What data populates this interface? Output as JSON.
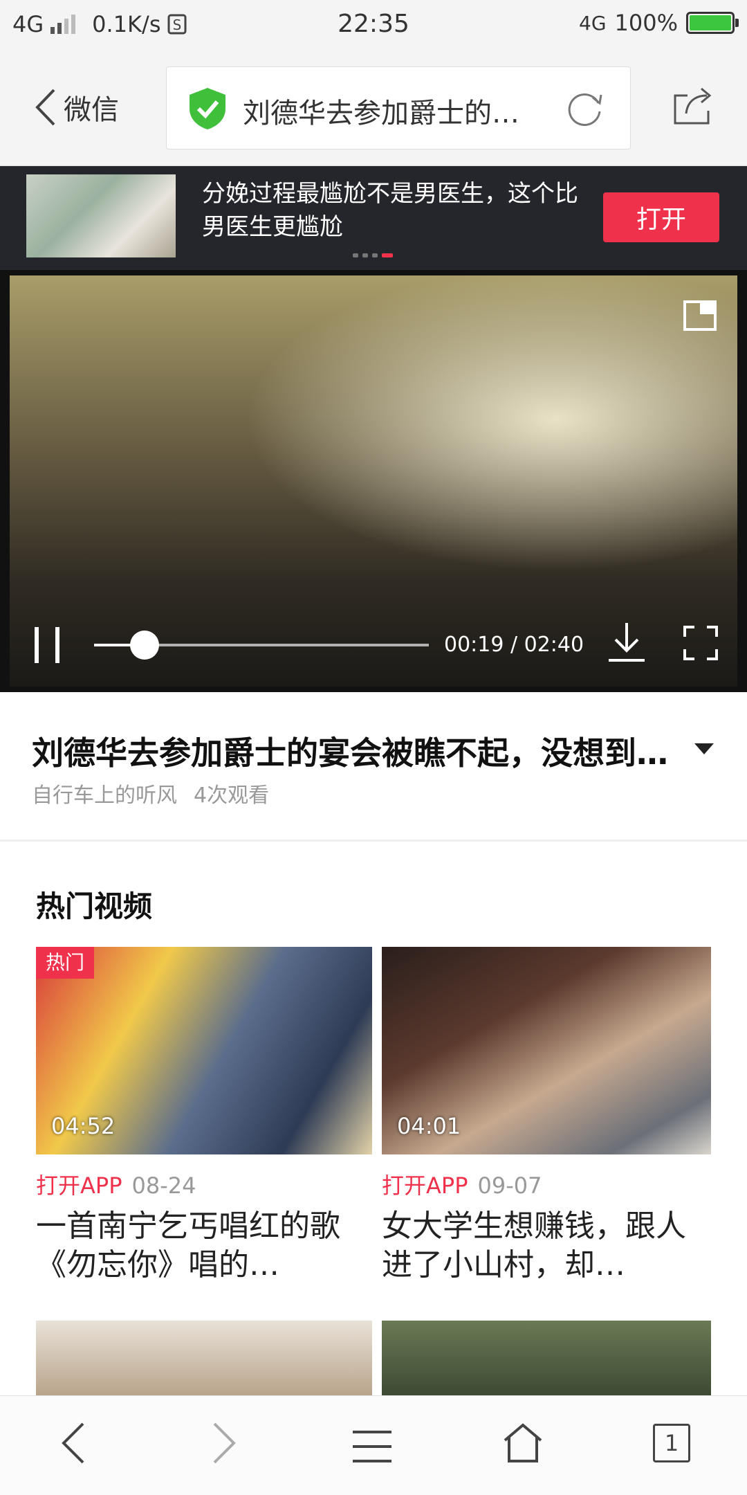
{
  "status_bar": {
    "network_left": "4G",
    "speed": "0.1K/s",
    "time": "22:35",
    "network_right": "4G",
    "battery": "100%",
    "colors": {
      "battery_fill": "#3cc640"
    }
  },
  "nav": {
    "back_label": "微信",
    "page_title": "刘德华去参加爵士的宴会被瞧不起，没想到…",
    "icons": {
      "back": "chevron-left-icon",
      "secure": "shield-check-icon",
      "reload": "refresh-icon",
      "share": "share-icon"
    }
  },
  "ad": {
    "text": "分娩过程最尴尬不是男医生，这个比男医生更尴尬",
    "open_label": "打开",
    "dots_count": 4,
    "active_dot": 3,
    "colors": {
      "accent": "#f0314b",
      "background": "#25262b"
    }
  },
  "player": {
    "current_time": "00:19",
    "duration": "02:40",
    "time_display": "00:19 / 02:40",
    "progress_fraction": 0.15,
    "icons": {
      "pip": "pip-icon",
      "pause": "pause-icon",
      "download": "download-icon",
      "fullscreen": "fullscreen-icon"
    }
  },
  "video_info": {
    "title": "刘德华去参加爵士的宴会被瞧不起，没想到…",
    "author": "自行车上的听风",
    "views": "4次观看"
  },
  "hot_videos": {
    "section_title": "热门视频",
    "items": [
      {
        "badge": "热门",
        "duration": "04:52",
        "app_label": "打开APP",
        "date": "08-24",
        "title": "一首南宁乞丐唱红的歌《勿忘你》唱的…"
      },
      {
        "badge": "",
        "duration": "04:01",
        "app_label": "打开APP",
        "date": "09-07",
        "title": "女大学生想赚钱，跟人进了小山村，却…"
      }
    ]
  },
  "bottom_bar": {
    "tab_count": "1",
    "icons": {
      "back": "arrow-left-icon",
      "forward": "arrow-right-icon",
      "menu": "menu-icon",
      "home": "home-icon",
      "tabs": "tabs-icon"
    }
  }
}
